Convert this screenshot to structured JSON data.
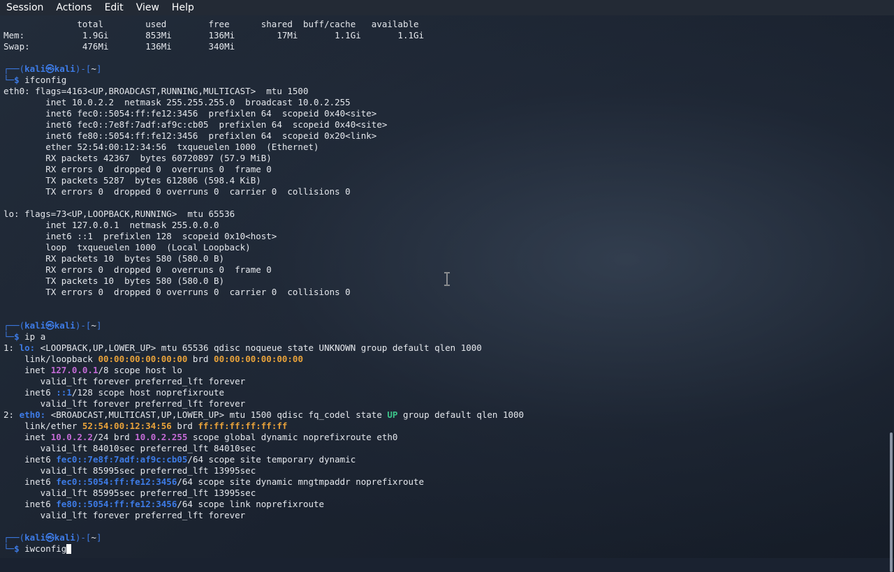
{
  "menu": [
    "Session",
    "Actions",
    "Edit",
    "View",
    "Help"
  ],
  "colors": {
    "prompt_blue": "#3d7be6",
    "mac_orange": "#e8a23a",
    "ipv4_magenta": "#c46bd6",
    "state_up_green": "#3cc48a",
    "text": "#e4e7ec"
  },
  "free": {
    "header": "              total        used        free      shared  buff/cache   available",
    "mem": "Mem:           1.9Gi       853Mi       136Mi        17Mi       1.1Gi       1.1Gi",
    "swap": "Swap:          476Mi       136Mi       340Mi"
  },
  "prompt": {
    "top_open": "┌──(",
    "user_host": "kali㉿kali",
    "top_close": ")-[",
    "dir": "~",
    "top_end": "]",
    "bottom": "└─",
    "dollar": "$"
  },
  "commands": [
    "ifconfig",
    "ip a",
    "iwconfig"
  ],
  "ifconfig": {
    "eth0": [
      "eth0: flags=4163<UP,BROADCAST,RUNNING,MULTICAST>  mtu 1500",
      "        inet 10.0.2.2  netmask 255.255.255.0  broadcast 10.0.2.255",
      "        inet6 fec0::5054:ff:fe12:3456  prefixlen 64  scopeid 0x40<site>",
      "        inet6 fec0::7e8f:7adf:af9c:cb05  prefixlen 64  scopeid 0x40<site>",
      "        inet6 fe80::5054:ff:fe12:3456  prefixlen 64  scopeid 0x20<link>",
      "        ether 52:54:00:12:34:56  txqueuelen 1000  (Ethernet)",
      "        RX packets 42367  bytes 60720897 (57.9 MiB)",
      "        RX errors 0  dropped 0  overruns 0  frame 0",
      "        TX packets 5287  bytes 612806 (598.4 KiB)",
      "        TX errors 0  dropped 0 overruns 0  carrier 0  collisions 0"
    ],
    "lo": [
      "lo: flags=73<UP,LOOPBACK,RUNNING>  mtu 65536",
      "        inet 127.0.0.1  netmask 255.0.0.0",
      "        inet6 ::1  prefixlen 128  scopeid 0x10<host>",
      "        loop  txqueuelen 1000  (Local Loopback)",
      "        RX packets 10  bytes 580 (580.0 B)",
      "        RX errors 0  dropped 0  overruns 0  frame 0",
      "        TX packets 10  bytes 580 (580.0 B)",
      "        TX errors 0  dropped 0 overruns 0  carrier 0  collisions 0"
    ]
  },
  "ipa": {
    "lo_head": [
      "1: ",
      "lo:",
      " <LOOPBACK,UP,LOWER_UP> mtu 65536 qdisc noqueue state UNKNOWN group default qlen 1000"
    ],
    "lo_link": [
      "    link/loopback ",
      "00:00:00:00:00:00",
      " brd ",
      "00:00:00:00:00:00"
    ],
    "lo_inet": [
      "    inet ",
      "127.0.0.1",
      "/8 scope host lo"
    ],
    "lo_valid1": "       valid_lft forever preferred_lft forever",
    "lo_inet6": [
      "    inet6 ",
      "::1",
      "/128 scope host noprefixroute"
    ],
    "lo_valid2": "       valid_lft forever preferred_lft forever",
    "eth_head": [
      "2: ",
      "eth0:",
      " <BROADCAST,MULTICAST,UP,LOWER_UP> mtu 1500 qdisc fq_codel state ",
      "UP",
      " group default qlen 1000"
    ],
    "eth_link": [
      "    link/ether ",
      "52:54:00:12:34:56",
      " brd ",
      "ff:ff:ff:ff:ff:ff"
    ],
    "eth_inet": [
      "    inet ",
      "10.0.2.2",
      "/24 brd ",
      "10.0.2.255",
      " scope global dynamic noprefixroute eth0"
    ],
    "eth_valid1": "       valid_lft 84010sec preferred_lft 84010sec",
    "eth_inet6a": [
      "    inet6 ",
      "fec0::7e8f:7adf:af9c:cb05",
      "/64 scope site temporary dynamic"
    ],
    "eth_valid2": "       valid_lft 85995sec preferred_lft 13995sec",
    "eth_inet6b": [
      "    inet6 ",
      "fec0::5054:ff:fe12:3456",
      "/64 scope site dynamic mngtmpaddr noprefixroute"
    ],
    "eth_valid3": "       valid_lft 85995sec preferred_lft 13995sec",
    "eth_inet6c": [
      "    inet6 ",
      "fe80::5054:ff:fe12:3456",
      "/64 scope link noprefixroute"
    ],
    "eth_valid4": "       valid_lft forever preferred_lft forever"
  },
  "scrollbar": {
    "position_fraction": 1.0
  }
}
